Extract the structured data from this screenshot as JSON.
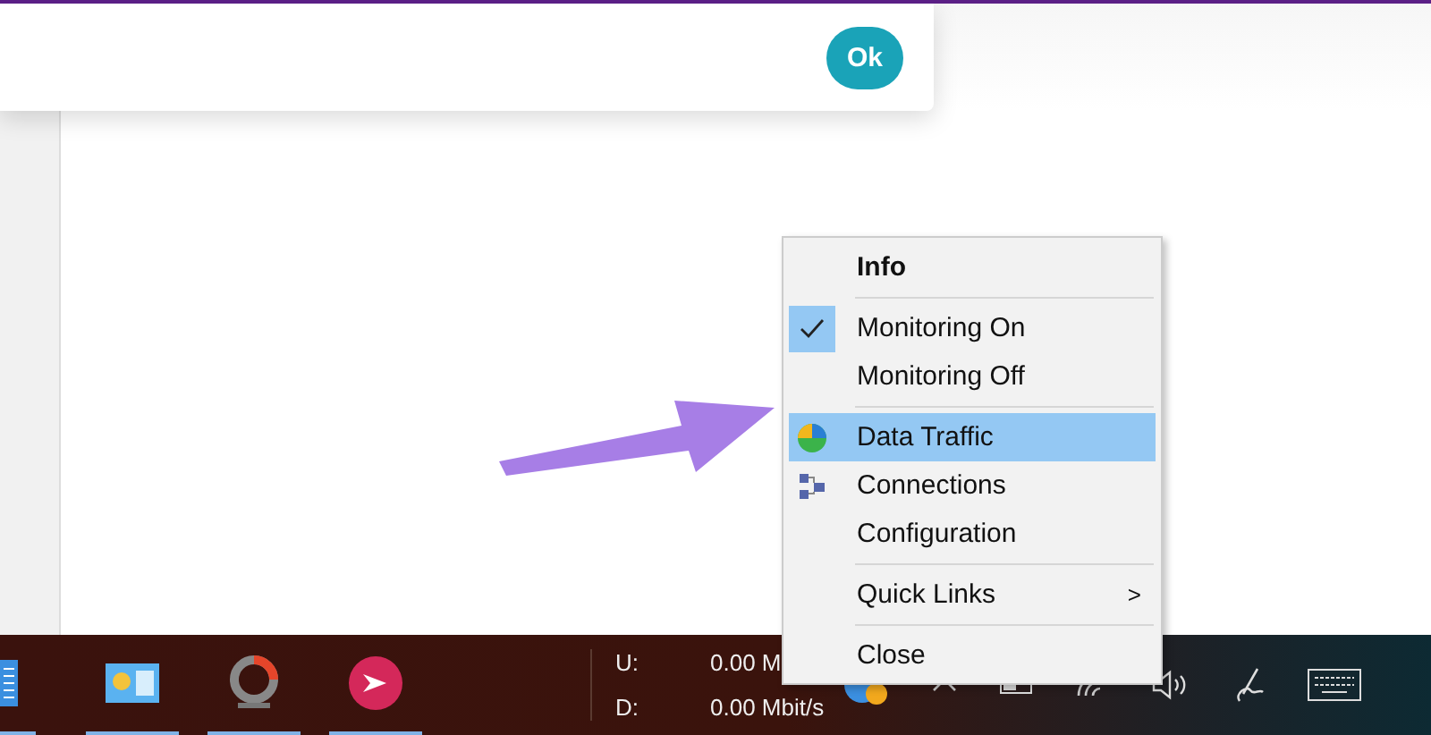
{
  "dialog": {
    "ok_button": "Ok"
  },
  "context_menu": {
    "items": [
      {
        "kind": "header",
        "label": "Info"
      },
      {
        "kind": "separator"
      },
      {
        "kind": "check",
        "label": "Monitoring On",
        "checked": true,
        "selected": false
      },
      {
        "kind": "check",
        "label": "Monitoring Off",
        "checked": false,
        "selected": false
      },
      {
        "kind": "separator"
      },
      {
        "kind": "pie",
        "label": "Data Traffic",
        "selected": true
      },
      {
        "kind": "network",
        "label": "Connections",
        "selected": false
      },
      {
        "kind": "plain",
        "label": "Configuration",
        "selected": false
      },
      {
        "kind": "separator"
      },
      {
        "kind": "submenu",
        "label": "Quick Links",
        "arrow": ">",
        "selected": false
      },
      {
        "kind": "separator"
      },
      {
        "kind": "plain",
        "label": "Close",
        "selected": false
      }
    ]
  },
  "taskbar": {
    "net_speed": [
      {
        "label": "U:",
        "value": "0.00 M"
      },
      {
        "label": "D:",
        "value": "0.00 Mbit/s"
      }
    ]
  }
}
